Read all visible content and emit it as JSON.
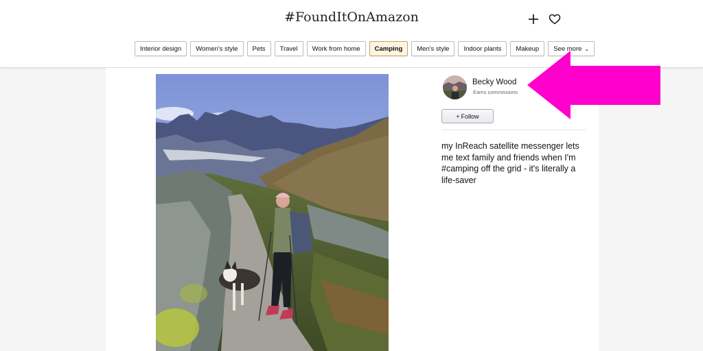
{
  "header": {
    "title": "#FoundItOnAmazon",
    "add_icon": "plus-icon",
    "favorite_icon": "heart-icon"
  },
  "categories": [
    {
      "label": "Interior design",
      "active": false
    },
    {
      "label": "Women's style",
      "active": false
    },
    {
      "label": "Pets",
      "active": false
    },
    {
      "label": "Travel",
      "active": false
    },
    {
      "label": "Work from home",
      "active": false
    },
    {
      "label": "Camping",
      "active": true
    },
    {
      "label": "Men's style",
      "active": false
    },
    {
      "label": "Indoor plants",
      "active": false
    },
    {
      "label": "Makeup",
      "active": false
    },
    {
      "label": "See more",
      "active": false
    }
  ],
  "post": {
    "author": "Becky Wood",
    "author_note": "Earns commissions",
    "follow_label": "Follow",
    "caption": "my InReach satellite messenger lets me text family and friends when I'm #camping off the grid - it's literally a life-saver"
  },
  "colors": {
    "active_chip_bg": "#fdf4e3",
    "annotation_arrow": "#ff00cc"
  }
}
